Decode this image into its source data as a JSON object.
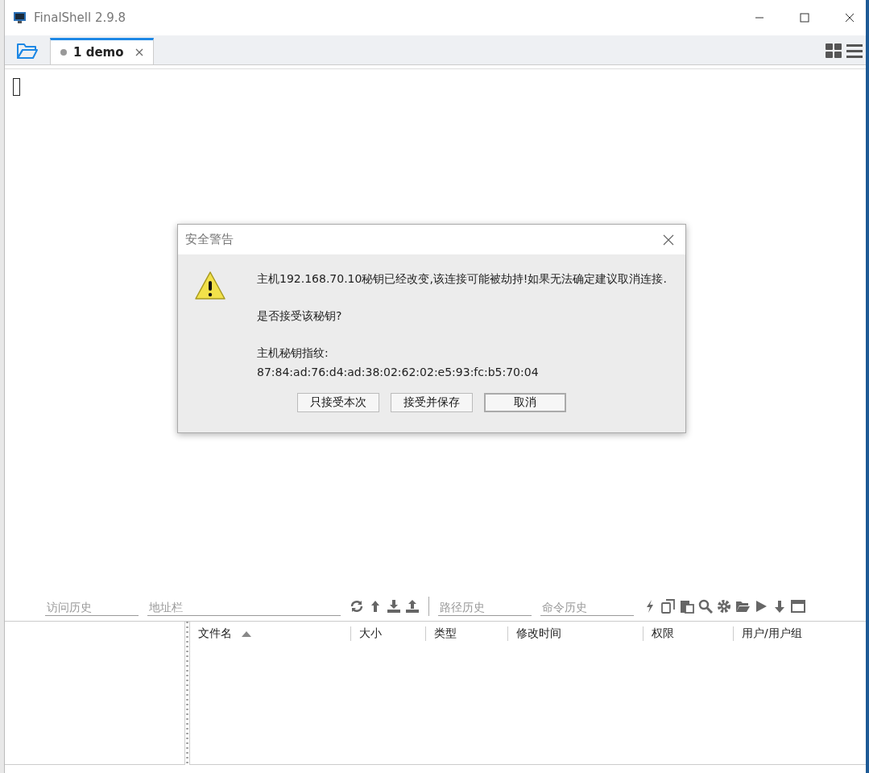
{
  "window": {
    "title": "FinalShell 2.9.8"
  },
  "tabs": [
    {
      "label": "1 demo",
      "selected": true
    }
  ],
  "dialog": {
    "title": "安全警告",
    "message": "主机192.168.70.10秘钥已经改变,该连接可能被劫持!如果无法确定建议取消连接.",
    "question": "是否接受该秘钥?",
    "fingerprint_label": "主机秘钥指纹:",
    "fingerprint": "87:84:ad:76:d4:ad:38:02:62:02:e5:93:fc:b5:70:04",
    "buttons": [
      {
        "label": "只接受本次",
        "focused": false
      },
      {
        "label": "接受并保存",
        "focused": false
      },
      {
        "label": "取消",
        "focused": true
      }
    ]
  },
  "toolbar": {
    "visit_history": {
      "placeholder": "访问历史"
    },
    "address_bar": {
      "placeholder": "地址栏"
    },
    "path_history": {
      "placeholder": "路径历史"
    },
    "command_history": {
      "placeholder": "命令历史"
    }
  },
  "file_table": {
    "columns": [
      {
        "label": "文件名",
        "sorted": true
      },
      {
        "label": "大小",
        "sorted": false
      },
      {
        "label": "类型",
        "sorted": false
      },
      {
        "label": "修改时间",
        "sorted": false
      },
      {
        "label": "权限",
        "sorted": false
      },
      {
        "label": "用户/用户组",
        "sorted": false
      }
    ]
  }
}
